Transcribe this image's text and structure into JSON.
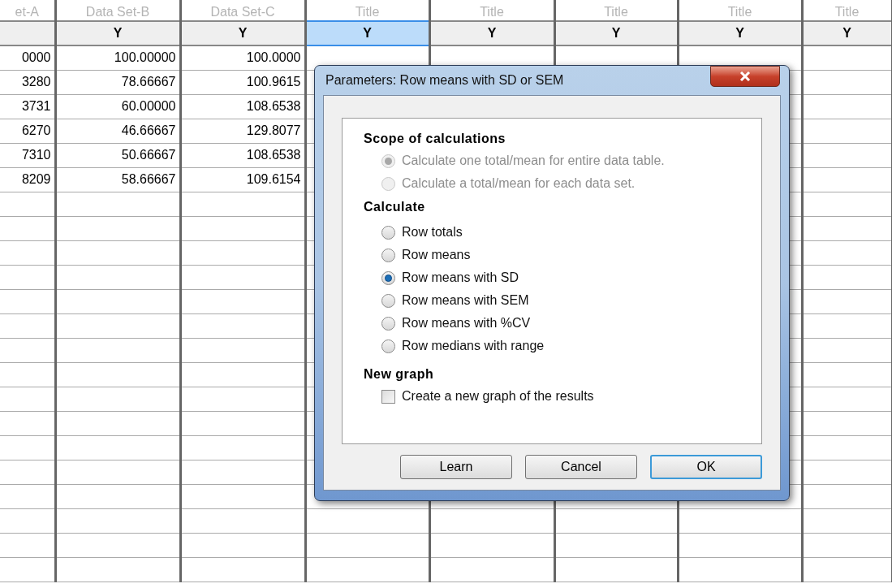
{
  "table": {
    "columns": [
      {
        "title": "et-A",
        "selected": false
      },
      {
        "title": "Data Set-B",
        "header": "Y",
        "selected": false
      },
      {
        "title": "Data Set-C",
        "header": "Y",
        "selected": false
      },
      {
        "title": "Title",
        "header": "Y",
        "selected": true
      },
      {
        "title": "Title",
        "header": "Y",
        "selected": false
      },
      {
        "title": "Title",
        "header": "Y",
        "selected": false
      },
      {
        "title": "Title",
        "header": "Y",
        "selected": false
      },
      {
        "title": "Title",
        "header": "Y",
        "selected": false
      }
    ],
    "rows": [
      [
        "0000",
        "100.00000",
        "100.0000"
      ],
      [
        "3280",
        "78.66667",
        "100.9615"
      ],
      [
        "3731",
        "60.00000",
        "108.6538"
      ],
      [
        "6270",
        "46.66667",
        "129.8077"
      ],
      [
        "7310",
        "50.66667",
        "108.6538"
      ],
      [
        "8209",
        "58.66667",
        "109.6154"
      ]
    ]
  },
  "dialog": {
    "title": "Parameters: Row means with SD or SEM",
    "sections": [
      {
        "kind": "radios",
        "heading": "Scope of calculations",
        "options": [
          {
            "label": "Calculate one total/mean for entire data table.",
            "selected": true,
            "disabled": true
          },
          {
            "label": "Calculate a total/mean for each data set.",
            "selected": false,
            "disabled": true
          }
        ]
      },
      {
        "kind": "radios",
        "heading": "Calculate",
        "options": [
          {
            "label": "Row totals",
            "selected": false,
            "disabled": false
          },
          {
            "label": "Row means",
            "selected": false,
            "disabled": false
          },
          {
            "label": "Row means with SD",
            "selected": true,
            "disabled": false
          },
          {
            "label": "Row means with SEM",
            "selected": false,
            "disabled": false
          },
          {
            "label": "Row means with %CV",
            "selected": false,
            "disabled": false
          },
          {
            "label": "Row medians with range",
            "selected": false,
            "disabled": false
          }
        ]
      },
      {
        "kind": "checkboxes",
        "heading": "New graph",
        "options": [
          {
            "label": "Create a new graph of the results",
            "checked": false
          }
        ]
      }
    ],
    "buttons": [
      {
        "label": "Learn",
        "default": false
      },
      {
        "label": "Cancel",
        "default": false
      },
      {
        "label": "OK",
        "default": true
      }
    ]
  }
}
